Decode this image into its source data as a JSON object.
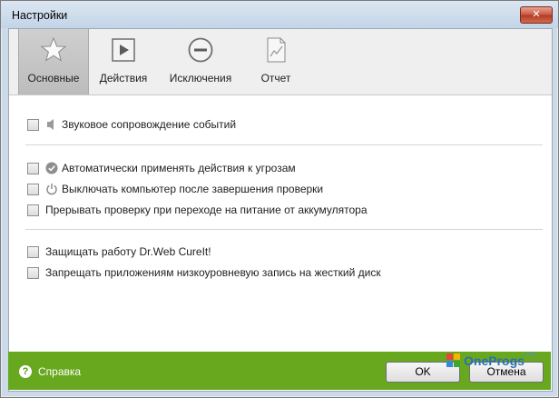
{
  "window": {
    "title": "Настройки",
    "close_glyph": "✕"
  },
  "tabs": [
    {
      "label": "Основные",
      "icon": "star-icon",
      "active": true
    },
    {
      "label": "Действия",
      "icon": "play-icon",
      "active": false
    },
    {
      "label": "Исключения",
      "icon": "minus-circle-icon",
      "active": false
    },
    {
      "label": "Отчет",
      "icon": "report-chart-icon",
      "active": false
    }
  ],
  "options": [
    {
      "label": "Звуковое сопровождение событий",
      "icon": "speaker-icon",
      "checked": false
    },
    {
      "label": "Автоматически применять действия к угрозам",
      "icon": "check-circle-icon",
      "checked": false
    },
    {
      "label": "Выключать компьютер после завершения проверки",
      "icon": "power-icon",
      "checked": false
    },
    {
      "label": "Прерывать проверку при переходе на питание от аккумулятора",
      "icon": "",
      "checked": false
    },
    {
      "label": "Защищать работу Dr.Web CureIt!",
      "icon": "",
      "checked": false
    },
    {
      "label": "Запрещать приложениям низкоуровневую запись на жесткий диск",
      "icon": "",
      "checked": false
    }
  ],
  "footer": {
    "help_label": "Справка",
    "help_glyph": "?",
    "ok_label": "OK",
    "cancel_label": "Отмена"
  },
  "watermark": {
    "text": "OneProgs",
    "suffix": ".com"
  },
  "colors": {
    "footer_green": "#67a81f",
    "window_frame": "#cbd9e8",
    "close_red": "#c8563e"
  }
}
